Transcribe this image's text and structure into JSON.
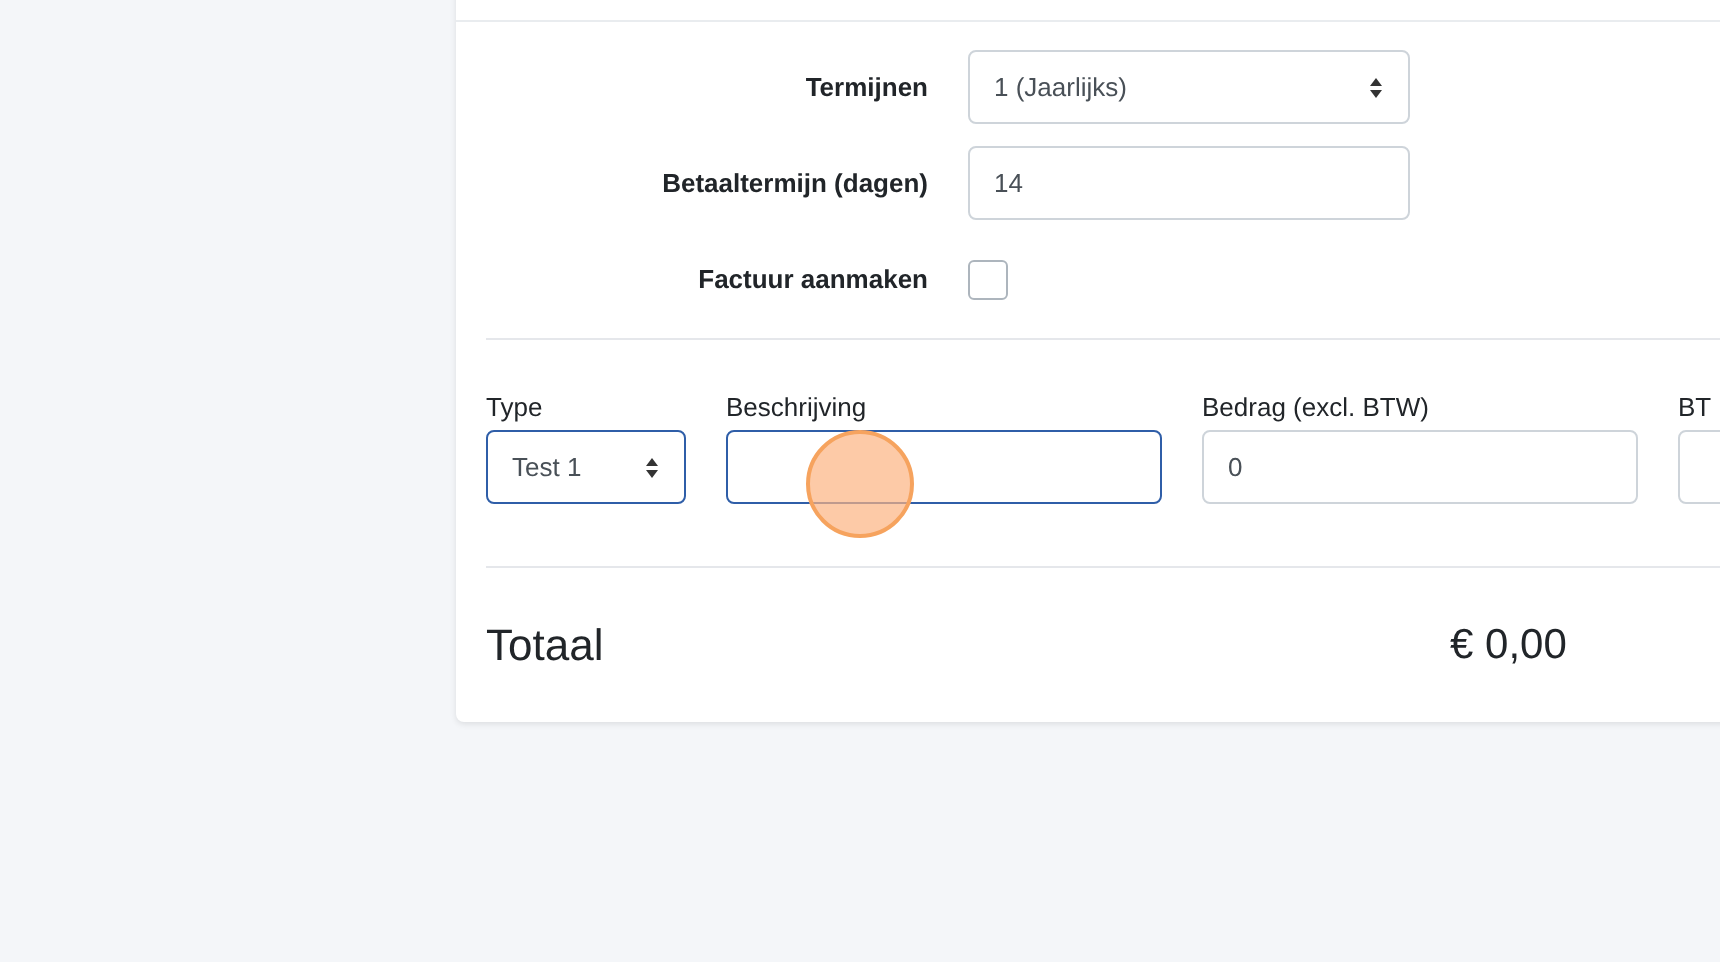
{
  "settings": [
    {
      "kind": "select",
      "label": "Termijnen",
      "value": "1 (Jaarlijks)"
    },
    {
      "kind": "input",
      "label": "Betaaltermijn (dagen)",
      "value": "14"
    },
    {
      "kind": "checkbox",
      "label": "Factuur aanmaken",
      "checked": false
    }
  ],
  "line_item": [
    {
      "kind": "select",
      "label": "Type",
      "value": "Test 1",
      "focused": true
    },
    {
      "kind": "input",
      "label": "Beschrijving",
      "focused": true
    },
    {
      "kind": "input",
      "label": "Bedrag (excl. BTW)",
      "value": "0",
      "focused": false
    },
    {
      "kind": "input",
      "label": "BT",
      "focused": false
    }
  ],
  "total": {
    "label": "Totaal",
    "amount": "€ 0,00"
  }
}
